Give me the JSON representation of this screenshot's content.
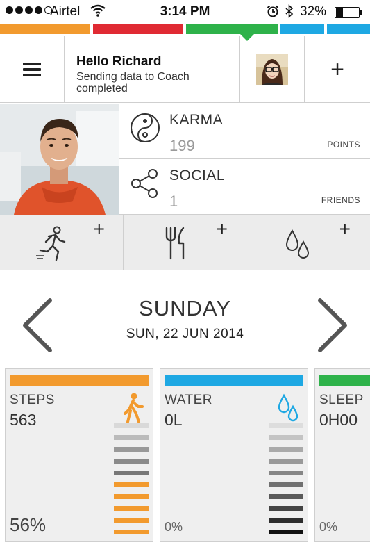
{
  "status_bar": {
    "carrier": "Airtel",
    "time": "3:14 PM",
    "battery": "32%",
    "battery_level": 0.32,
    "signal_bars": 4
  },
  "colors": {
    "orange": "#f29a2e",
    "red": "#e02a33",
    "green": "#2eb24a",
    "blue": "#1ea8e3"
  },
  "header": {
    "title": "Hello Richard",
    "subtitle": "Sending data to Coach completed"
  },
  "karma": {
    "label": "KARMA",
    "value": "199",
    "unit": "POINTS",
    "icon": "yin-yang-icon"
  },
  "social": {
    "label": "SOCIAL",
    "value": "1",
    "unit": "FRIENDS",
    "icon": "share-icon"
  },
  "quick_add": [
    {
      "icon": "running-icon",
      "plus": "+"
    },
    {
      "icon": "fork-knife-icon",
      "plus": "+"
    },
    {
      "icon": "water-drops-icon",
      "plus": "+"
    }
  ],
  "day": {
    "name": "SUNDAY",
    "date": "SUN, 22 JUN 2014"
  },
  "cards": [
    {
      "title": "STEPS",
      "value": "563",
      "percent": "56%",
      "color": "#f29a2e",
      "icon": "walking-icon"
    },
    {
      "title": "WATER",
      "value": "0L",
      "percent": "0%",
      "color": "#1ea8e3",
      "icon": "water-drops-icon"
    },
    {
      "title": "SLEEP",
      "value": "0H00",
      "percent": "0%",
      "color": "#2eb24a",
      "icon": "sleep-icon"
    }
  ],
  "plus_symbol": "+"
}
